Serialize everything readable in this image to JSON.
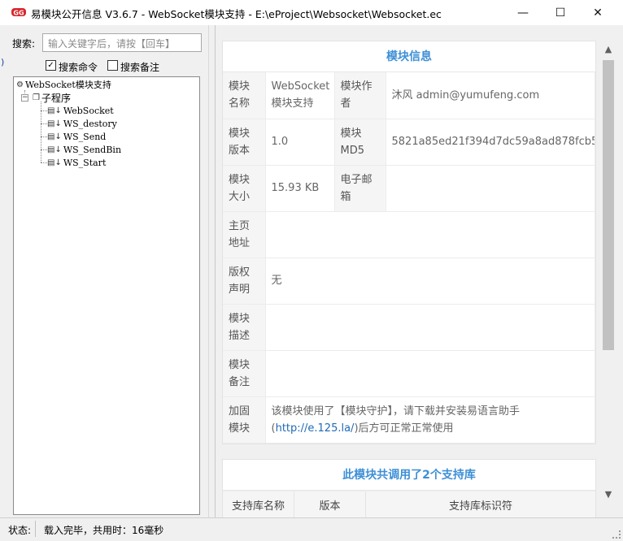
{
  "window": {
    "title": "易模块公开信息 V3.6.7 - WebSocket模块支持 - E:\\eProject\\Websocket\\Websocket.ec",
    "minimize_glyph": "—",
    "maximize_glyph": "☐",
    "close_glyph": "✕",
    "app_icon": "app-logo-icon"
  },
  "search": {
    "label": "搜索:",
    "placeholder": "输入关键字后，请按【回车】",
    "stray_char": ")",
    "opt_command_label": "搜索命令",
    "opt_command_checked": true,
    "opt_note_label": "搜索备注",
    "opt_note_checked": false
  },
  "tree": {
    "root": "WebSocket模块支持",
    "group": "子程序",
    "items": [
      "WebSocket",
      "WS_destory",
      "WS_Send",
      "WS_SendBin",
      "WS_Start"
    ]
  },
  "module_info": {
    "title": "模块信息",
    "rows": [
      {
        "l1": "模块名称",
        "v1": "WebSocket模块支持",
        "l2": "模块作者",
        "v2": "沐风 admin@yumufeng.com"
      },
      {
        "l1": "模块版本",
        "v1": "1.0",
        "l2": "模块MD5",
        "v2": "5821a85ed21f394d7dc59a8ad878fcb5"
      },
      {
        "l1": "模块大小",
        "v1": "15.93 KB",
        "l2": "电子邮箱",
        "v2": ""
      }
    ],
    "homepage_label": "主页地址",
    "homepage_value": "",
    "copyright_label": "版权声明",
    "copyright_value": "无",
    "desc_label": "模块描述",
    "desc_value": "",
    "note_label": "模块备注",
    "note_value": "",
    "protect_label": "加固模块",
    "protect_text": "该模块使用了【模块守护】，请下载并安装易语言助手(",
    "protect_link": "http://e.125.la/",
    "protect_tail": ")后方可正常正常使用"
  },
  "support_libs": {
    "title": "此模块共调用了2个支持库",
    "headers": [
      "支持库名称",
      "版本",
      "支持库标识符"
    ]
  },
  "status": {
    "label": "状态:",
    "text": "载入完毕，共用时：16毫秒"
  },
  "scroll": {
    "up_glyph": "▲",
    "down_glyph": "▼"
  },
  "colors": {
    "accent": "#3d8fd6",
    "link": "#1f6ab5"
  }
}
